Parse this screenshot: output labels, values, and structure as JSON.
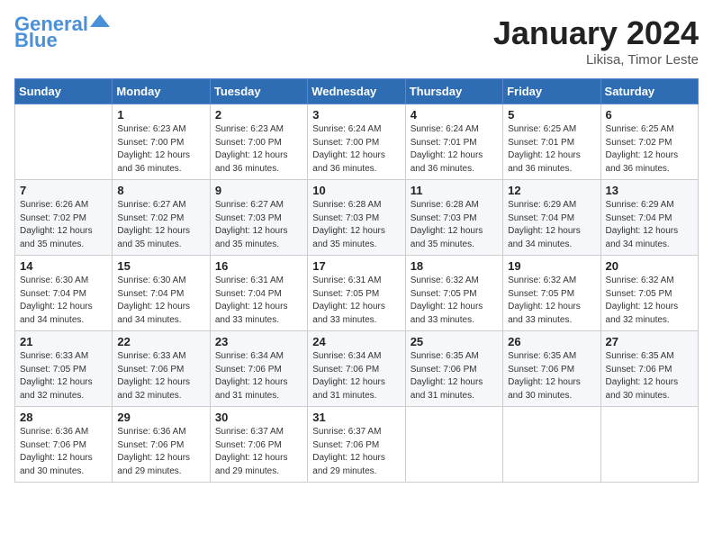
{
  "header": {
    "logo_line1": "General",
    "logo_line2": "Blue",
    "month": "January 2024",
    "location": "Likisa, Timor Leste"
  },
  "weekdays": [
    "Sunday",
    "Monday",
    "Tuesday",
    "Wednesday",
    "Thursday",
    "Friday",
    "Saturday"
  ],
  "weeks": [
    [
      {
        "day": "",
        "sunrise": "",
        "sunset": "",
        "daylight": ""
      },
      {
        "day": "1",
        "sunrise": "6:23 AM",
        "sunset": "7:00 PM",
        "daylight": "12 hours and 36 minutes."
      },
      {
        "day": "2",
        "sunrise": "6:23 AM",
        "sunset": "7:00 PM",
        "daylight": "12 hours and 36 minutes."
      },
      {
        "day": "3",
        "sunrise": "6:24 AM",
        "sunset": "7:00 PM",
        "daylight": "12 hours and 36 minutes."
      },
      {
        "day": "4",
        "sunrise": "6:24 AM",
        "sunset": "7:01 PM",
        "daylight": "12 hours and 36 minutes."
      },
      {
        "day": "5",
        "sunrise": "6:25 AM",
        "sunset": "7:01 PM",
        "daylight": "12 hours and 36 minutes."
      },
      {
        "day": "6",
        "sunrise": "6:25 AM",
        "sunset": "7:02 PM",
        "daylight": "12 hours and 36 minutes."
      }
    ],
    [
      {
        "day": "7",
        "sunrise": "6:26 AM",
        "sunset": "7:02 PM",
        "daylight": "12 hours and 35 minutes."
      },
      {
        "day": "8",
        "sunrise": "6:27 AM",
        "sunset": "7:02 PM",
        "daylight": "12 hours and 35 minutes."
      },
      {
        "day": "9",
        "sunrise": "6:27 AM",
        "sunset": "7:03 PM",
        "daylight": "12 hours and 35 minutes."
      },
      {
        "day": "10",
        "sunrise": "6:28 AM",
        "sunset": "7:03 PM",
        "daylight": "12 hours and 35 minutes."
      },
      {
        "day": "11",
        "sunrise": "6:28 AM",
        "sunset": "7:03 PM",
        "daylight": "12 hours and 35 minutes."
      },
      {
        "day": "12",
        "sunrise": "6:29 AM",
        "sunset": "7:04 PM",
        "daylight": "12 hours and 34 minutes."
      },
      {
        "day": "13",
        "sunrise": "6:29 AM",
        "sunset": "7:04 PM",
        "daylight": "12 hours and 34 minutes."
      }
    ],
    [
      {
        "day": "14",
        "sunrise": "6:30 AM",
        "sunset": "7:04 PM",
        "daylight": "12 hours and 34 minutes."
      },
      {
        "day": "15",
        "sunrise": "6:30 AM",
        "sunset": "7:04 PM",
        "daylight": "12 hours and 34 minutes."
      },
      {
        "day": "16",
        "sunrise": "6:31 AM",
        "sunset": "7:04 PM",
        "daylight": "12 hours and 33 minutes."
      },
      {
        "day": "17",
        "sunrise": "6:31 AM",
        "sunset": "7:05 PM",
        "daylight": "12 hours and 33 minutes."
      },
      {
        "day": "18",
        "sunrise": "6:32 AM",
        "sunset": "7:05 PM",
        "daylight": "12 hours and 33 minutes."
      },
      {
        "day": "19",
        "sunrise": "6:32 AM",
        "sunset": "7:05 PM",
        "daylight": "12 hours and 33 minutes."
      },
      {
        "day": "20",
        "sunrise": "6:32 AM",
        "sunset": "7:05 PM",
        "daylight": "12 hours and 32 minutes."
      }
    ],
    [
      {
        "day": "21",
        "sunrise": "6:33 AM",
        "sunset": "7:05 PM",
        "daylight": "12 hours and 32 minutes."
      },
      {
        "day": "22",
        "sunrise": "6:33 AM",
        "sunset": "7:06 PM",
        "daylight": "12 hours and 32 minutes."
      },
      {
        "day": "23",
        "sunrise": "6:34 AM",
        "sunset": "7:06 PM",
        "daylight": "12 hours and 31 minutes."
      },
      {
        "day": "24",
        "sunrise": "6:34 AM",
        "sunset": "7:06 PM",
        "daylight": "12 hours and 31 minutes."
      },
      {
        "day": "25",
        "sunrise": "6:35 AM",
        "sunset": "7:06 PM",
        "daylight": "12 hours and 31 minutes."
      },
      {
        "day": "26",
        "sunrise": "6:35 AM",
        "sunset": "7:06 PM",
        "daylight": "12 hours and 30 minutes."
      },
      {
        "day": "27",
        "sunrise": "6:35 AM",
        "sunset": "7:06 PM",
        "daylight": "12 hours and 30 minutes."
      }
    ],
    [
      {
        "day": "28",
        "sunrise": "6:36 AM",
        "sunset": "7:06 PM",
        "daylight": "12 hours and 30 minutes."
      },
      {
        "day": "29",
        "sunrise": "6:36 AM",
        "sunset": "7:06 PM",
        "daylight": "12 hours and 29 minutes."
      },
      {
        "day": "30",
        "sunrise": "6:37 AM",
        "sunset": "7:06 PM",
        "daylight": "12 hours and 29 minutes."
      },
      {
        "day": "31",
        "sunrise": "6:37 AM",
        "sunset": "7:06 PM",
        "daylight": "12 hours and 29 minutes."
      },
      {
        "day": "",
        "sunrise": "",
        "sunset": "",
        "daylight": ""
      },
      {
        "day": "",
        "sunrise": "",
        "sunset": "",
        "daylight": ""
      },
      {
        "day": "",
        "sunrise": "",
        "sunset": "",
        "daylight": ""
      }
    ]
  ]
}
